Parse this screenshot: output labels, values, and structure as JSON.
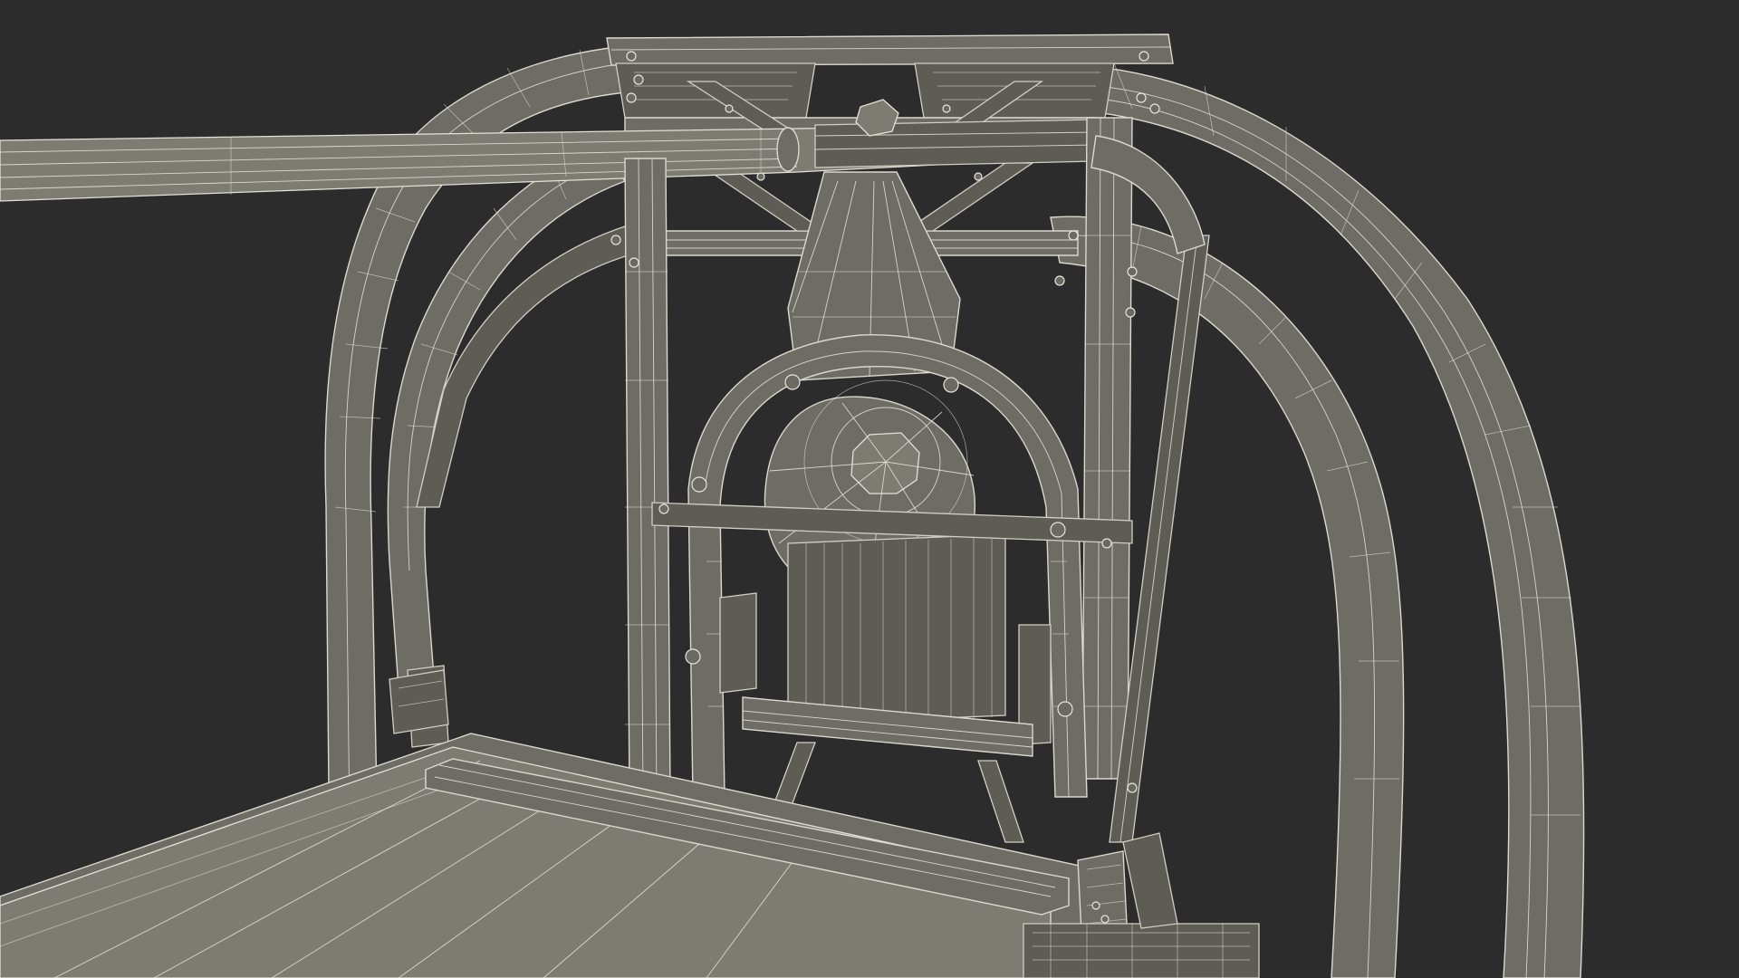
{
  "scene": {
    "background_color": "#2c2c2c",
    "wire_fill": "#6d6d65",
    "wire_edge": "#d9d9cf",
    "subject": "printing-press-wireframe"
  }
}
